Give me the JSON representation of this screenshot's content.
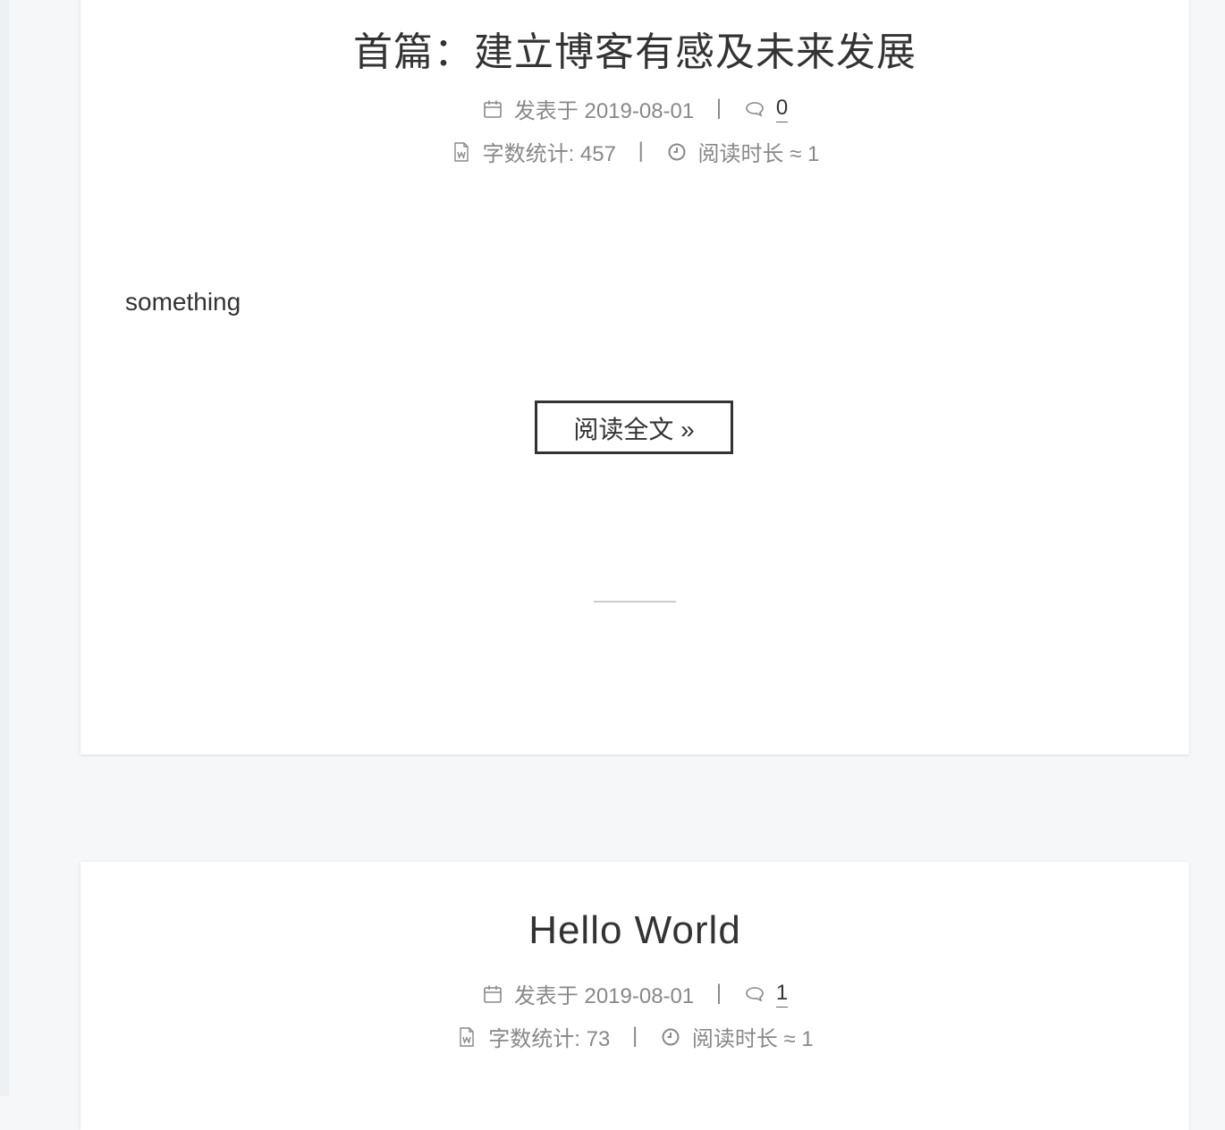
{
  "posts": [
    {
      "title": "首篇：建立博客有感及未来发展",
      "date_label": "发表于 2019-08-01",
      "comment_count": "0",
      "word_count_label": "字数统计: 457",
      "read_time_label": "阅读时长 ≈ 1",
      "excerpt": "something",
      "read_more_label": "阅读全文 »"
    },
    {
      "title": "Hello World",
      "date_label": "发表于 2019-08-01",
      "comment_count": "1",
      "word_count_label": "字数统计: 73",
      "read_time_label": "阅读时长 ≈ 1"
    }
  ],
  "separator": "|",
  "icons": {
    "date": "calendar-icon",
    "comments": "comment-icon",
    "words": "file-word-icon",
    "time": "clock-icon"
  },
  "colors": {
    "background": "#f5f7f9",
    "card": "#ffffff",
    "title": "#333333",
    "meta": "#888888"
  }
}
